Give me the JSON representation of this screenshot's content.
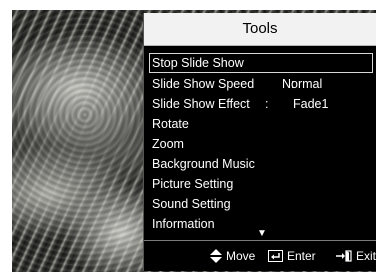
{
  "panel": {
    "title": "Tools"
  },
  "menu": {
    "items": [
      {
        "label": "Stop Slide Show",
        "selected": true
      },
      {
        "label": "Slide Show Speed",
        "separator": ":",
        "value": "Normal"
      },
      {
        "label": "Slide Show Effect",
        "separator": ":",
        "value": "Fade1"
      },
      {
        "label": "Rotate"
      },
      {
        "label": "Zoom"
      },
      {
        "label": "Background Music"
      },
      {
        "label": "Picture Setting"
      },
      {
        "label": "Sound Setting"
      },
      {
        "label": "Information"
      }
    ],
    "more_icon": "down-triangle-icon",
    "more_glyph": "▼"
  },
  "footer": {
    "move_label": "Move",
    "move_icon": "up-down-arrows-icon",
    "enter_label": "Enter",
    "enter_icon": "enter-icon",
    "exit_label": "Exit",
    "exit_icon": "exit-icon"
  },
  "colors": {
    "panel_background": "#000000",
    "header_background": "#f2f2f2",
    "text": "#ffffff",
    "selection_border": "#d8d8d8"
  }
}
